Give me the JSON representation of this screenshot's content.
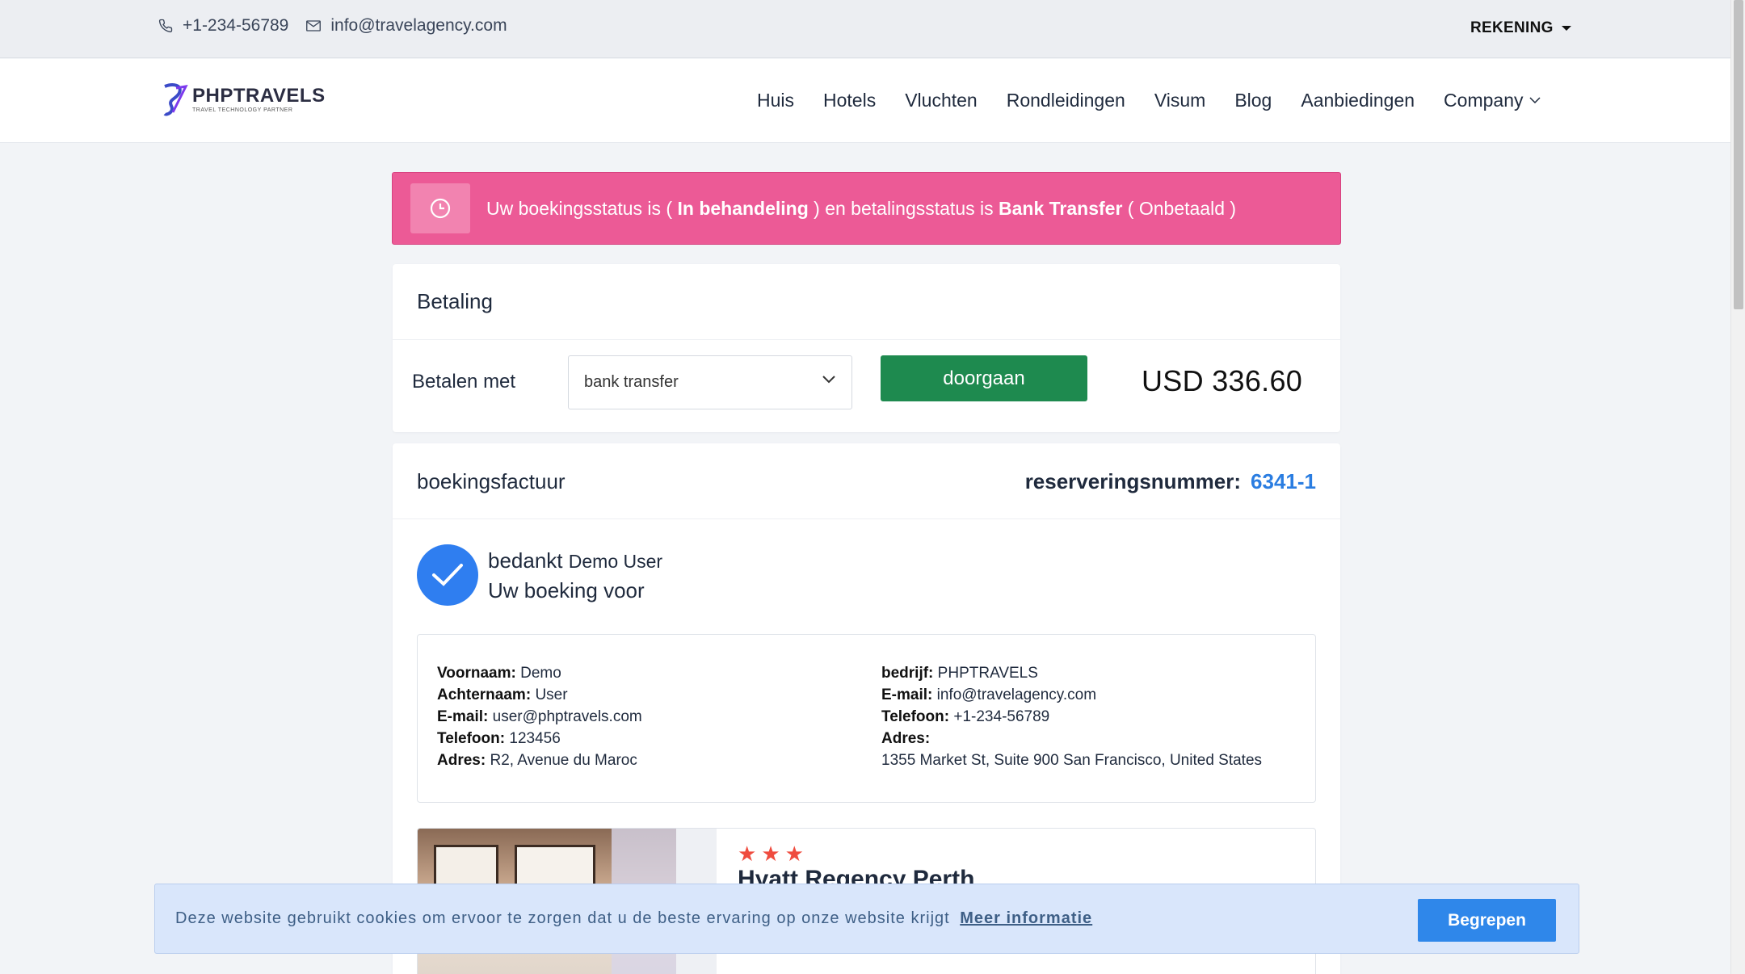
{
  "topbar": {
    "phone": "+1-234-56789",
    "email": "info@travelagency.com",
    "account_label": "REKENING"
  },
  "navbar": {
    "logo_brand": "PHPTRAVELS",
    "logo_tagline": "TRAVEL TECHNOLOGY PARTNER",
    "links": [
      "Huis",
      "Hotels",
      "Vluchten",
      "Rondleidingen",
      "Visum",
      "Blog",
      "Aanbiedingen",
      "Company"
    ]
  },
  "alert": {
    "prefix": "Uw boekingsstatus is ( ",
    "booking_status": "In behandeling",
    "middle": " ) en betalingsstatus is ",
    "payment_method": "Bank Transfer",
    "suffix": " ( Onbetaald )",
    "color": "#ec5a96"
  },
  "payment": {
    "title": "Betaling",
    "pay_with_label": "Betalen met",
    "selected_method": "bank transfer",
    "proceed_label": "doorgaan",
    "amount": "USD 336.60",
    "button_color": "#1e8a4f"
  },
  "invoice": {
    "title": "boekingsfactuur",
    "reservation_label": "reserveringsnummer:",
    "reservation_number": "6341-1",
    "thanks_label": "bedankt",
    "user_name": "Demo User",
    "booking_for": "Uw boeking voor",
    "customer": {
      "first_name_label": "Voornaam:",
      "first_name": "Demo",
      "last_name_label": "Achternaam:",
      "last_name": "User",
      "email_label": "E-mail:",
      "email": "user@phptravels.com",
      "phone_label": "Telefoon:",
      "phone": "123456",
      "address_label": "Adres:",
      "address": "R2, Avenue du Maroc"
    },
    "company": {
      "company_label": "bedrijf:",
      "company": "PHPTRAVELS",
      "email_label": "E-mail:",
      "email": "info@travelagency.com",
      "phone_label": "Telefoon:",
      "phone": "+1-234-56789",
      "address_label": "Adres:",
      "address": "1355 Market St, Suite 900 San Francisco, United States"
    },
    "hotel": {
      "name": "Hyatt Regency Perth",
      "stars": 3
    }
  },
  "cookie": {
    "message": "Deze website gebruikt cookies om ervoor te zorgen dat u de beste ervaring op onze website krijgt",
    "more_info": "Meer informatie",
    "accept_label": "Begrepen"
  }
}
